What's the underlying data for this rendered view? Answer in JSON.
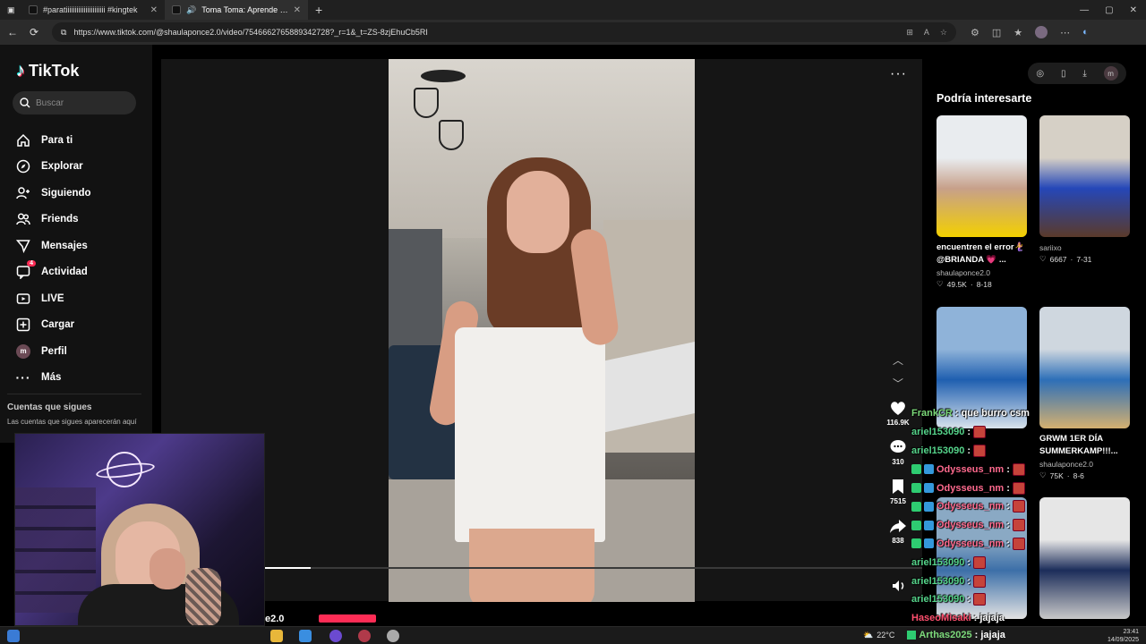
{
  "browser": {
    "tabs": [
      {
        "label": "#paratiiiiiiiiiiiiiiiiiiiiii #kingtek",
        "active": false
      },
      {
        "label": "Toma Toma: Aprende el Bail",
        "active": true
      }
    ],
    "url": "https://www.tiktok.com/@shaulaponce2.0/video/7546662765889342728?_r=1&_t=ZS-8zjEhuCb5RI"
  },
  "tiktok": {
    "logo": "TikTok",
    "search_placeholder": "Buscar",
    "menu": [
      {
        "label": "Para ti",
        "icon": "home-icon"
      },
      {
        "label": "Explorar",
        "icon": "compass-icon"
      },
      {
        "label": "Siguiendo",
        "icon": "following-icon"
      },
      {
        "label": "Friends",
        "icon": "friends-icon"
      },
      {
        "label": "Mensajes",
        "icon": "messages-icon"
      },
      {
        "label": "Actividad",
        "icon": "activity-icon",
        "badge": "4"
      },
      {
        "label": "LIVE",
        "icon": "live-icon"
      },
      {
        "label": "Cargar",
        "icon": "upload-icon"
      },
      {
        "label": "Perfil",
        "icon": "profile-avatar",
        "avatar_letter": "m"
      },
      {
        "label": "Más",
        "icon": "more-icon"
      }
    ],
    "following_header": "Cuentas que sigues",
    "following_sub": "Las cuentas que sigues aparecerán aquí",
    "video": {
      "actions": [
        {
          "name": "like",
          "count": "116.9K"
        },
        {
          "name": "comment",
          "count": "310"
        },
        {
          "name": "save",
          "count": "7515"
        },
        {
          "name": "share",
          "count": "838"
        }
      ],
      "progress": 0.07,
      "caption_peek": "e2.0"
    },
    "rail": {
      "profile_letter": "m",
      "header": "Podría interesarte",
      "cards": [
        {
          "title": "encuentren el error🧜‍♀️ @BRIANDA 💗 ...",
          "user": "shaulaponce2.0",
          "likes": "49.5K",
          "date": "8-18",
          "colors": [
            "#e9ecef",
            "#c7a08a",
            "#f3d000"
          ]
        },
        {
          "title": "",
          "user": "sariixo",
          "likes": "6667",
          "date": "7-31",
          "colors": [
            "#d6d0c6",
            "#2547b8",
            "#5a3a2a"
          ]
        },
        {
          "title": "",
          "user": "",
          "likes": "",
          "date": "",
          "colors": [
            "#8fb3d9",
            "#1f5fb0",
            "#d9e3ec"
          ]
        },
        {
          "title": "GRWM 1ER DÍA SUMMERKAMP!!!...",
          "user": "shaulaponce2.0",
          "likes": "75K",
          "date": "8-6",
          "colors": [
            "#cfd7df",
            "#2d6fb8",
            "#d4b070"
          ]
        },
        {
          "title": "",
          "user": "",
          "likes": "",
          "date": "",
          "colors": [
            "#8aa9c4",
            "#3c6fa8",
            "#e2e2e2"
          ]
        },
        {
          "title": "",
          "user": "",
          "likes": "",
          "date": "",
          "colors": [
            "#e6e6e6",
            "#1c2d5a",
            "#c8c8c8"
          ]
        }
      ]
    }
  },
  "chat": [
    {
      "user": "FrankCR",
      "color": "#7cd97a",
      "msg": ": que burro csm",
      "badges": 0,
      "emote": false
    },
    {
      "user": "ariel153090",
      "color": "#55d38a",
      "msg": ":",
      "badges": 0,
      "emote": true
    },
    {
      "user": "ariel153090",
      "color": "#55d38a",
      "msg": ":",
      "badges": 0,
      "emote": true
    },
    {
      "user": "Odysseus_nm",
      "color": "#ff6a8e",
      "msg": ":",
      "badges": 2,
      "emote": true
    },
    {
      "user": "Odysseus_nm",
      "color": "#ff6a8e",
      "msg": ":",
      "badges": 2,
      "emote": true
    },
    {
      "user": "Odysseus_nm",
      "color": "#ff6a8e",
      "msg": ":",
      "badges": 2,
      "emote": true
    },
    {
      "user": "Odysseus_nm",
      "color": "#ff6a8e",
      "msg": ":",
      "badges": 2,
      "emote": true
    },
    {
      "user": "Odysseus_nm",
      "color": "#ff6a8e",
      "msg": ":",
      "badges": 2,
      "emote": true
    },
    {
      "user": "ariel153090",
      "color": "#55d38a",
      "msg": ":",
      "badges": 0,
      "emote": true
    },
    {
      "user": "ariel153090",
      "color": "#55d38a",
      "msg": ":",
      "badges": 0,
      "emote": true
    },
    {
      "user": "ariel153090",
      "color": "#55d38a",
      "msg": ":",
      "badges": 0,
      "emote": true
    },
    {
      "user": "HaseoMisaki",
      "color": "#ff4f6e",
      "msg": ": jajaja",
      "badges": 0,
      "emote": false
    }
  ],
  "taskbar": {
    "weather": "22°C",
    "chat_overlay": {
      "user": "Arthas2025",
      "msg": ": jajaja"
    },
    "time": "23:41",
    "date": "14/09/2025"
  }
}
